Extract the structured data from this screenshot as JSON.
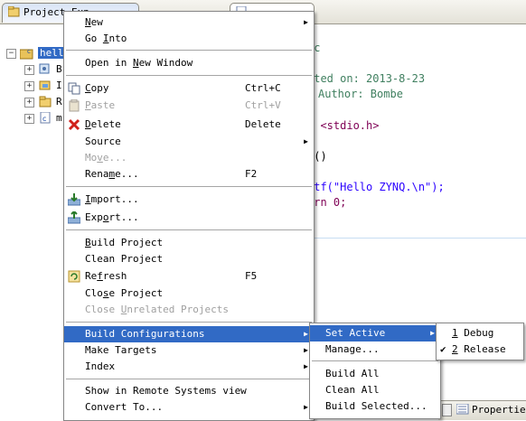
{
  "explorer": {
    "tab_label": "Project Exp",
    "project_name": "hell",
    "tree_items": [
      "B",
      "I",
      "R",
      "m"
    ]
  },
  "editor": {
    "tab_label": "",
    "lines": [
      {
        "text": ".c",
        "class": "cm"
      },
      {
        "text": "ated on: 2013-8-23",
        "class": "cm"
      },
      {
        "text": "Author: Bombe",
        "class": "cm"
      },
      {
        "text": "e <stdio.h>",
        "class": "kw-inc"
      },
      {
        "text": "n()",
        "class": ""
      },
      {
        "text": "ntf(\"Hello ZYNQ.\\n\");",
        "class": "printf"
      },
      {
        "text": "urn 0;",
        "class": "ret"
      }
    ]
  },
  "context_menu": {
    "items": [
      {
        "label": "New",
        "mn": "N",
        "arrow": true
      },
      {
        "label": "Go Into",
        "mn": "I"
      },
      {
        "sep": true
      },
      {
        "label": "Open in New Window",
        "mn": "N"
      },
      {
        "sep": true
      },
      {
        "label": "Copy",
        "mn": "C",
        "accel": "Ctrl+C",
        "icon": "copy-icon"
      },
      {
        "label": "Paste",
        "mn": "P",
        "accel": "Ctrl+V",
        "disabled": true,
        "icon": "paste-icon"
      },
      {
        "label": "Delete",
        "mn": "D",
        "accel": "Delete",
        "icon": "delete-icon"
      },
      {
        "label": "Source",
        "mn": "S",
        "arrow": true
      },
      {
        "label": "Move...",
        "mn": "v",
        "disabled": true
      },
      {
        "label": "Rename...",
        "mn": "m",
        "accel": "F2"
      },
      {
        "sep": true
      },
      {
        "label": "Import...",
        "mn": "I",
        "icon": "import-icon"
      },
      {
        "label": "Export...",
        "mn": "o",
        "icon": "export-icon"
      },
      {
        "sep": true
      },
      {
        "label": "Build Project",
        "mn": "B"
      },
      {
        "label": "Clean Project",
        "mn": "C"
      },
      {
        "label": "Refresh",
        "mn": "f",
        "accel": "F5",
        "icon": "refresh-icon"
      },
      {
        "label": "Close Project",
        "mn": "s"
      },
      {
        "label": "Close Unrelated Projects",
        "mn": "U",
        "disabled": true
      },
      {
        "sep": true
      },
      {
        "label": "Build Configurations",
        "selected": true,
        "arrow": true
      },
      {
        "label": "Make Targets",
        "arrow": true
      },
      {
        "label": "Index",
        "arrow": true
      },
      {
        "sep": true
      },
      {
        "label": "Show in Remote Systems view"
      },
      {
        "label": "Convert To...",
        "arrow": true
      }
    ]
  },
  "build_config_menu": {
    "items": [
      {
        "label": "Set Active",
        "selected": true,
        "arrow": true
      },
      {
        "label": "Manage..."
      },
      {
        "sep": true
      },
      {
        "label": "Build All"
      },
      {
        "label": "Clean All"
      },
      {
        "label": "Build Selected..."
      }
    ]
  },
  "set_active_menu": {
    "items": [
      {
        "label": "1 Debug",
        "checked": false
      },
      {
        "label": "2 Release",
        "checked": true
      }
    ]
  },
  "bottom_tabs": {
    "properties_label": "Properties"
  }
}
